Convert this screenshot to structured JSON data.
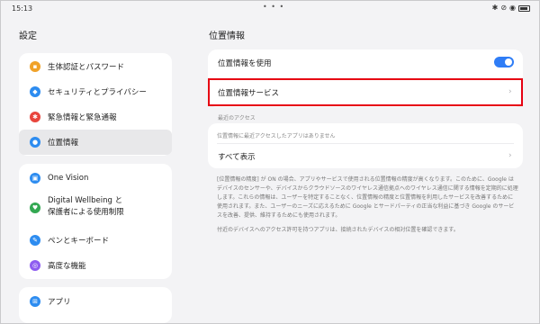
{
  "status_bar": {
    "time": "15:13",
    "dots": "• • •"
  },
  "left_panel": {
    "title": "設定",
    "group1": [
      {
        "label": "生体認証とパスワード",
        "color": "#f0a229",
        "icon": "lock-icon"
      },
      {
        "label": "セキュリティとプライバシー",
        "color": "#2d8cf0",
        "icon": "shield-icon"
      },
      {
        "label": "緊急情報と緊急通報",
        "color": "#e8453c",
        "icon": "asterisk-icon"
      },
      {
        "label": "位置情報",
        "color": "#2d8cf0",
        "icon": "location-pin-icon",
        "active": true
      }
    ],
    "group2": [
      {
        "label": "One Vision",
        "color": "#2d8cf0",
        "icon": "one-vision-icon"
      },
      {
        "label_line1": "Digital Wellbeing と",
        "label_line2": "保護者による使用制限",
        "color": "#33a852",
        "icon": "wellbeing-icon"
      },
      {
        "label": "ペンとキーボード",
        "color": "#2d8cf0",
        "icon": "pen-icon"
      },
      {
        "label": "高度な機能",
        "color": "#8e5cf0",
        "icon": "advanced-features-icon"
      }
    ],
    "group3": [
      {
        "label": "アプリ",
        "color": "#2d8cf0",
        "icon": "apps-icon"
      }
    ]
  },
  "right_panel": {
    "title": "位置情報",
    "use_location_label": "位置情報を使用",
    "use_location_on": true,
    "location_services_label": "位置情報サービス",
    "recent_access_section": "最近のアクセス",
    "no_recent_access": "位置情報に最近アクセスしたアプリはありません",
    "show_all_label": "すべて表示",
    "description1": "[位置情報の精度] が ON の場合、アプリやサービスで使用される位置情報の精度が高くなります。このために、Google はデバイスのセンサーや、デバイスからクラウドソースのワイヤレス通信拠点へのワイヤレス通信に関する情報を定期的に処理します。これらの情報は、ユーザーを特定することなく、位置情報の精度と位置情報を利用したサービスを改善するために使用されます。また、ユーザーのニーズに応えるために Google とサードパーティの正当な利益に基づき Google のサービスを改善、提供、維持するためにも使用されます。",
    "description2": "付近のデバイスへのアクセス許可を持つアプリは、接続されたデバイスの相対位置を確認できます。"
  },
  "colors": {
    "accent": "#2f7df6",
    "highlight": "#e60012"
  }
}
